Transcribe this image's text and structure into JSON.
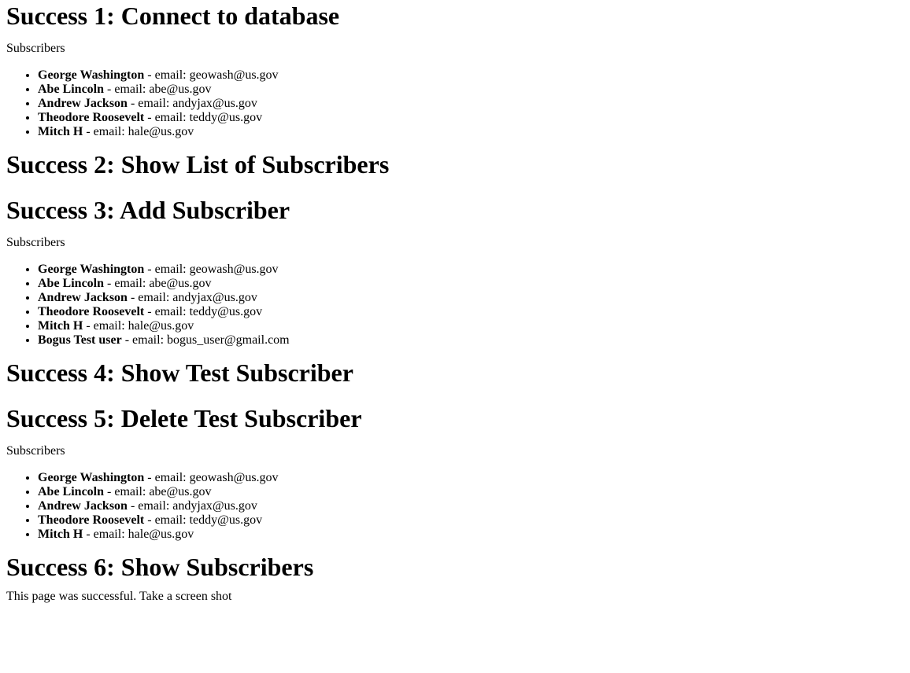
{
  "sections": {
    "s1": {
      "heading": "Success 1: Connect to database"
    },
    "s2": {
      "heading": "Success 2: Show List of Subscribers"
    },
    "s3": {
      "heading": "Success 3: Add Subscriber"
    },
    "s4": {
      "heading": "Success 4: Show Test Subscriber"
    },
    "s5": {
      "heading": "Success 5: Delete Test Subscriber"
    },
    "s6": {
      "heading": "Success 6: Show Subscribers"
    }
  },
  "lists": {
    "list1": {
      "label": "Subscribers",
      "items": [
        {
          "name": "George Washington",
          "sep": " - email: ",
          "email": "geowash@us.gov"
        },
        {
          "name": "Abe Lincoln",
          "sep": " - email: ",
          "email": "abe@us.gov"
        },
        {
          "name": "Andrew Jackson",
          "sep": " - email: ",
          "email": "andyjax@us.gov"
        },
        {
          "name": "Theodore Roosevelt",
          "sep": " - email: ",
          "email": "teddy@us.gov"
        },
        {
          "name": "Mitch H",
          "sep": " - email: ",
          "email": "hale@us.gov"
        }
      ]
    },
    "list2": {
      "label": "Subscribers",
      "items": [
        {
          "name": "George Washington",
          "sep": " - email: ",
          "email": "geowash@us.gov"
        },
        {
          "name": "Abe Lincoln",
          "sep": " - email: ",
          "email": "abe@us.gov"
        },
        {
          "name": "Andrew Jackson",
          "sep": " - email: ",
          "email": "andyjax@us.gov"
        },
        {
          "name": "Theodore Roosevelt",
          "sep": " - email: ",
          "email": "teddy@us.gov"
        },
        {
          "name": "Mitch H",
          "sep": " - email: ",
          "email": "hale@us.gov"
        },
        {
          "name": "Bogus Test user",
          "sep": " - email: ",
          "email": "bogus_user@gmail.com"
        }
      ]
    },
    "list3": {
      "label": "Subscribers",
      "items": [
        {
          "name": "George Washington",
          "sep": " - email: ",
          "email": "geowash@us.gov"
        },
        {
          "name": "Abe Lincoln",
          "sep": " - email: ",
          "email": "abe@us.gov"
        },
        {
          "name": "Andrew Jackson",
          "sep": " - email: ",
          "email": "andyjax@us.gov"
        },
        {
          "name": "Theodore Roosevelt",
          "sep": " - email: ",
          "email": "teddy@us.gov"
        },
        {
          "name": "Mitch H",
          "sep": " - email: ",
          "email": "hale@us.gov"
        }
      ]
    }
  },
  "footer": {
    "message": "This page was successful. Take a screen shot"
  }
}
